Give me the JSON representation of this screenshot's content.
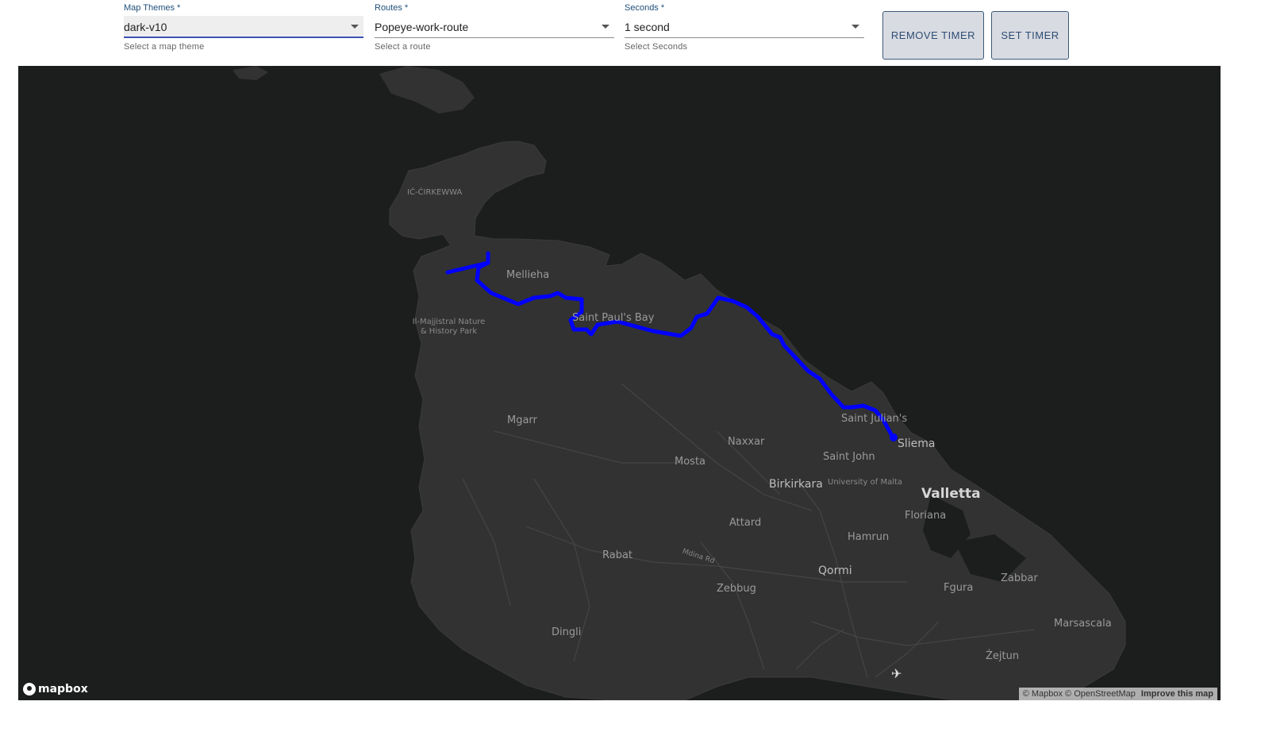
{
  "controls": {
    "map_theme": {
      "label": "Map Themes *",
      "value": "dark-v10",
      "help": "Select a map theme"
    },
    "route": {
      "label": "Routes *",
      "value": "Popeye-work-route",
      "help": "Select a route"
    },
    "seconds": {
      "label": "Seconds *",
      "value": "1 second",
      "help": "Select Seconds"
    },
    "remove_timer": "REMOVE TIMER",
    "set_timer": "SET TIMER"
  },
  "map": {
    "route_color": "#0000ff",
    "places": {
      "cirkewwa": "IĊ-ĊIRKEWWA",
      "mellieha": "Mellieha",
      "majjistral": "Il-Majjistral Nature & History Park",
      "saint_pauls_bay": "Saint Paul's Bay",
      "mgarr": "Mgarr",
      "naxxar": "Naxxar",
      "mosta": "Mosta",
      "saint_julians": "Saint Julian's",
      "sliema": "Sliema",
      "saint_john": "Saint John",
      "birkirkara": "Birkirkara",
      "university": "University of Malta",
      "valletta": "Valletta",
      "floriana": "Floriana",
      "attard": "Attard",
      "hamrun": "Hamrun",
      "rabat": "Rabat",
      "mdina_rd": "Mdina Rd",
      "qormi": "Qormi",
      "zabbar": "Zabbar",
      "fgura": "Fgura",
      "zebbug": "Zebbug",
      "marsascala": "Marsascala",
      "dingli": "Dingli",
      "zejtun": "Żejtun"
    },
    "logo": "mapbox",
    "attribution": "© Mapbox © OpenStreetMap",
    "improve": "Improve this map"
  }
}
